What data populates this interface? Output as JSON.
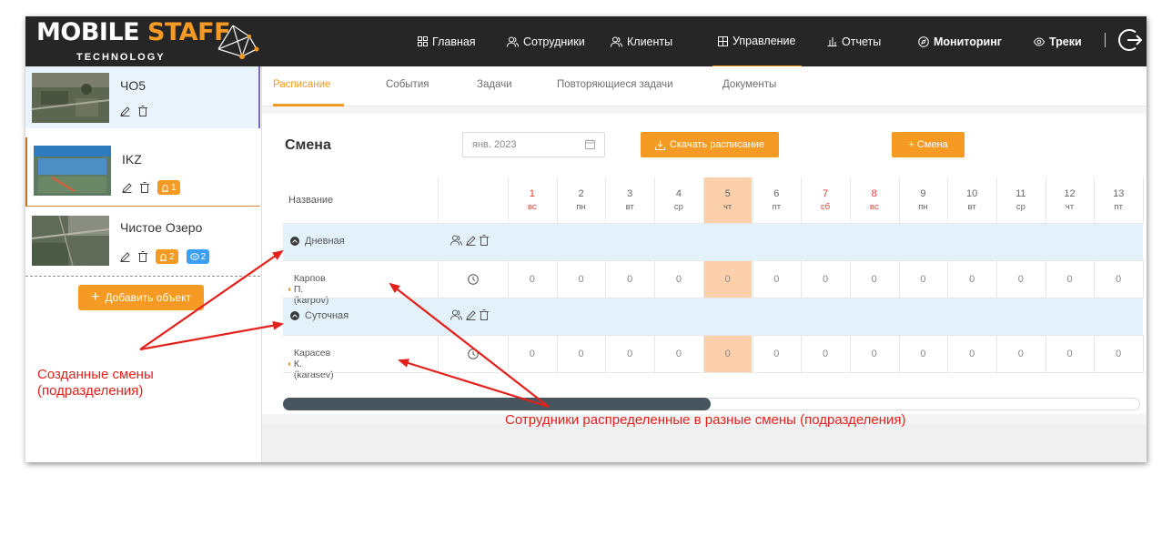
{
  "header": {
    "logo_main": "MOBILE",
    "logo_accent": "STAFF",
    "logo_sub": "TECHNOLOGY",
    "nav": [
      {
        "label": "Главная",
        "icon": "grid-icon"
      },
      {
        "label": "Сотрудники",
        "icon": "users-icon"
      },
      {
        "label": "Клиенты",
        "icon": "users-icon"
      },
      {
        "label": "Управление",
        "icon": "calendar-grid-icon",
        "active": true
      },
      {
        "label": "Отчеты",
        "icon": "bar-chart-icon"
      },
      {
        "label": "Мониторинг",
        "icon": "compass-icon"
      },
      {
        "label": "Треки",
        "icon": "eye-icon"
      }
    ],
    "separator": "|"
  },
  "sidebar": {
    "objects": [
      {
        "name": "ЧО5",
        "badges": []
      },
      {
        "name": "IKZ",
        "badges": [
          {
            "icon": "alarm-icon",
            "count": "1",
            "color": "#f59a23"
          }
        ]
      },
      {
        "name": "Чистое Озеро",
        "badges": [
          {
            "icon": "alarm-icon",
            "count": "2",
            "color": "#f59a23"
          },
          {
            "icon": "chat-icon",
            "count": "2",
            "color": "#3a9ff5"
          }
        ]
      }
    ],
    "add_button": "Добавить объект"
  },
  "tabs": [
    "Расписание",
    "События",
    "Задачи",
    "Повторяющиеся задачи",
    "Документы"
  ],
  "schedule": {
    "title": "Смена",
    "date_value": "янв. 2023",
    "download_button": "Скачать расписание",
    "add_shift_button": "+ Смена",
    "name_header": "Название",
    "days": [
      {
        "num": "1",
        "wd": "вс",
        "weekend": true
      },
      {
        "num": "2",
        "wd": "пн"
      },
      {
        "num": "3",
        "wd": "вт"
      },
      {
        "num": "4",
        "wd": "ср"
      },
      {
        "num": "5",
        "wd": "чт",
        "today": true
      },
      {
        "num": "6",
        "wd": "пт"
      },
      {
        "num": "7",
        "wd": "сб",
        "weekend": true
      },
      {
        "num": "8",
        "wd": "вс",
        "weekend": true
      },
      {
        "num": "9",
        "wd": "пн"
      },
      {
        "num": "10",
        "wd": "вт"
      },
      {
        "num": "11",
        "wd": "ср"
      },
      {
        "num": "12",
        "wd": "чт"
      },
      {
        "num": "13",
        "wd": "пт"
      }
    ],
    "groups": [
      {
        "name": "Дневная",
        "employee": {
          "name": "Карпов П. (karpov)",
          "values": [
            "0",
            "0",
            "0",
            "0",
            "0",
            "0",
            "0",
            "0",
            "0",
            "0",
            "0",
            "0",
            "0"
          ]
        }
      },
      {
        "name": "Суточная",
        "employee": {
          "name": "Карасев К. (karasev)",
          "values": [
            "0",
            "0",
            "0",
            "0",
            "0",
            "0",
            "0",
            "0",
            "0",
            "0",
            "0",
            "0",
            "0"
          ]
        }
      }
    ]
  },
  "annotations": {
    "label_left_1": "Созданные смены",
    "label_left_2": "(подразделения)",
    "label_bottom": "Сотрудники распределенные в разные смены (подразделения)"
  },
  "colors": {
    "accent": "#f59a23",
    "annotation": "#e3211c",
    "band": "#e3f1fa",
    "today": "#fbd0aa"
  }
}
